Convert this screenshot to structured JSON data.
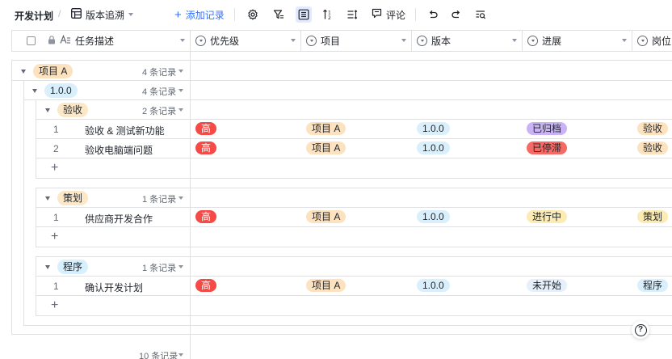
{
  "toolbar": {
    "title": "开发计划",
    "separator": "/",
    "view_name": "版本追溯",
    "add_label": "添加记录",
    "comment_label": "评论"
  },
  "columns": [
    {
      "label": "任务描述"
    },
    {
      "label": "优先级"
    },
    {
      "label": "项目"
    },
    {
      "label": "版本"
    },
    {
      "label": "进展"
    },
    {
      "label": "岗位"
    }
  ],
  "groups": {
    "project": {
      "label": "项目 A",
      "count": "4 条记录"
    },
    "version": {
      "label": "1.0.0",
      "count": "4 条记录"
    },
    "sub": [
      {
        "label": "验收",
        "count": "2 条记录",
        "color": "#fce8c6"
      },
      {
        "label": "策划",
        "count": "1 条记录",
        "color": "#fce8c6"
      },
      {
        "label": "程序",
        "count": "1 条记录",
        "color": "#d6f0fd"
      }
    ]
  },
  "rows": [
    {
      "num": "1",
      "task": "验收 & 测试新功能",
      "priority": "高",
      "project": "项目 A",
      "version": "1.0.0",
      "progress": "已归档",
      "role": "验收"
    },
    {
      "num": "2",
      "task": "验收电脑端问题",
      "priority": "高",
      "project": "项目 A",
      "version": "1.0.0",
      "progress": "已停滞",
      "role": "验收"
    },
    {
      "num": "1",
      "task": "供应商开发合作",
      "priority": "高",
      "project": "项目 A",
      "version": "1.0.0",
      "progress": "进行中",
      "role": "策划"
    },
    {
      "num": "1",
      "task": "确认开发计划",
      "priority": "高",
      "project": "项目 A",
      "version": "1.0.0",
      "progress": "未开始",
      "role": "程序"
    }
  ],
  "add_row_symbol": "+",
  "footer": {
    "count": "10 条记录"
  },
  "help_symbol": "?",
  "colors": {
    "accent": "#3370ff",
    "priority_high": "#f54a45",
    "project_tag": "#fde2c0",
    "version_tag": "#d9f0fc",
    "progress_archived": "#c9b3f5",
    "progress_stalled": "#f76964",
    "progress_inprogress": "#fcecb3",
    "progress_notstarted": "#e6f0fb",
    "role_acceptance": "#fde2c0",
    "role_planning": "#fcecb3",
    "role_program": "#d9f0fc"
  },
  "icons": [
    "table-icon",
    "settings-icon",
    "filter-icon",
    "group-icon",
    "sort-icon",
    "row-height-icon",
    "comment-icon",
    "undo-icon",
    "redo-icon",
    "search-icon",
    "lock-icon",
    "text-field-icon",
    "single-select-icon",
    "help-icon"
  ]
}
